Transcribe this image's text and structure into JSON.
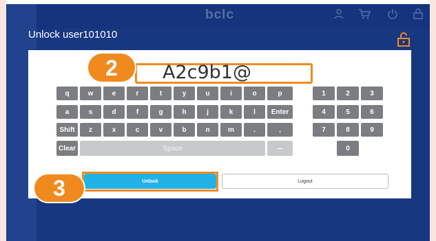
{
  "app": {
    "logo": "bclc"
  },
  "modal": {
    "title": "Unlock user101010",
    "password_value": "A2c9b1@",
    "step_password": "2",
    "step_unlock": "3",
    "unlock_label": "Unlock",
    "logout_label": "Logout"
  },
  "keyboard": {
    "row1": [
      "q",
      "w",
      "e",
      "r",
      "t",
      "y",
      "u",
      "i",
      "o",
      "p"
    ],
    "row2": [
      "a",
      "s",
      "d",
      "f",
      "g",
      "h",
      "j",
      "k",
      "l",
      "Enter"
    ],
    "row3": [
      "Shift",
      "z",
      "x",
      "c",
      "v",
      "b",
      "n",
      "m",
      ".",
      ","
    ],
    "clear": "Clear",
    "space": "Space",
    "backspace": "—"
  },
  "numpad": [
    "1",
    "2",
    "3",
    "4",
    "5",
    "6",
    "7",
    "8",
    "9",
    "0"
  ],
  "colors": {
    "accent_orange": "#f08a1e",
    "unlock_blue": "#22b3e6",
    "background_blue": "#1f47a6",
    "key_gray": "#7b7d80"
  },
  "icons": [
    "unlock-icon",
    "user-icon",
    "cart-icon",
    "power-icon",
    "lock-icon"
  ]
}
